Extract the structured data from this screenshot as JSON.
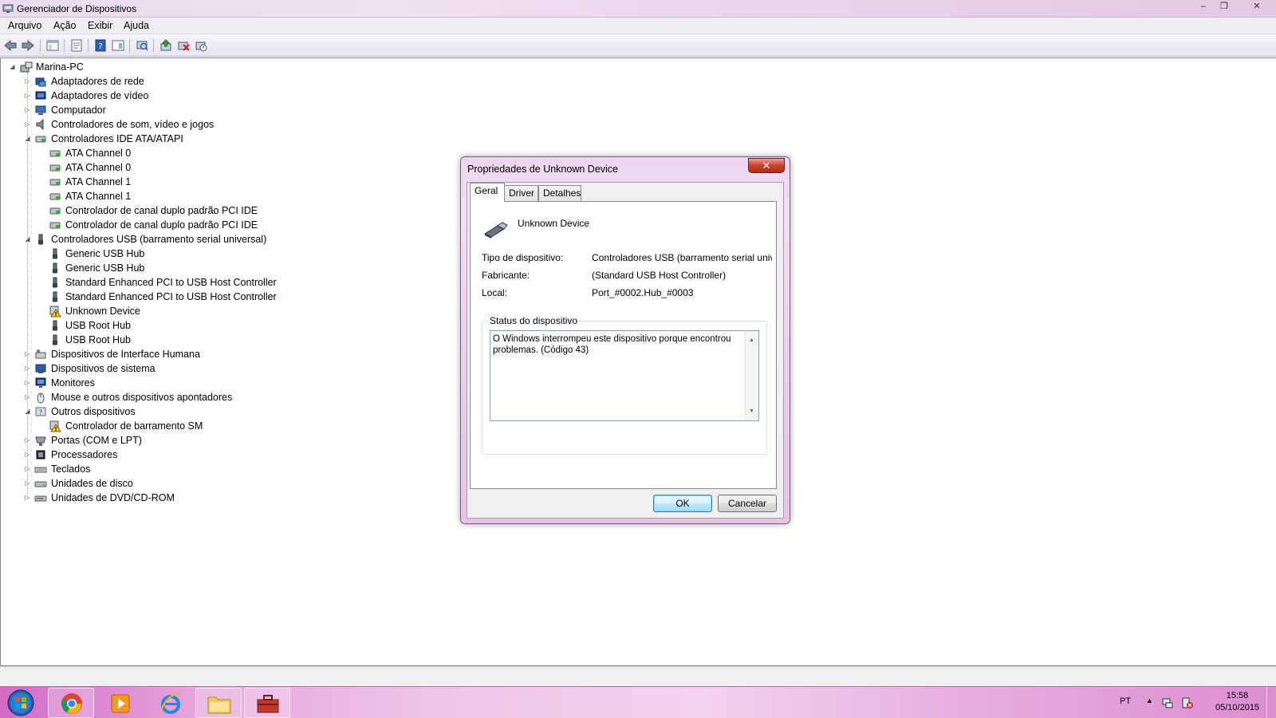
{
  "window": {
    "title": "Gerenciador de Dispositivos",
    "minimize": "‒",
    "maximize": "❐",
    "close": "✕"
  },
  "menu": {
    "items": [
      "Arquivo",
      "Ação",
      "Exibir",
      "Ajuda"
    ]
  },
  "toolbar": {
    "icons": [
      "back-icon",
      "forward-icon",
      "console-tree-icon",
      "properties-icon",
      "help-icon",
      "action-pane-icon",
      "scan-hardware-icon",
      "update-driver-icon",
      "uninstall-icon",
      "disable-icon"
    ]
  },
  "tree": {
    "root": "Marina-PC",
    "nodes": [
      {
        "label": "Adaptadores de rede",
        "icon": "network-adapter-icon",
        "level": 1,
        "expander": "collapsed"
      },
      {
        "label": "Adaptadores de vídeo",
        "icon": "display-adapter-icon",
        "level": 1,
        "expander": "collapsed"
      },
      {
        "label": "Computador",
        "icon": "computer-icon",
        "level": 1,
        "expander": "collapsed"
      },
      {
        "label": "Controladores de som, vídeo e jogos",
        "icon": "speaker-icon",
        "level": 1,
        "expander": "collapsed"
      },
      {
        "label": "Controladores IDE ATA/ATAPI",
        "icon": "ide-controller-icon",
        "level": 1,
        "expander": "expanded"
      },
      {
        "label": "ATA Channel 0",
        "icon": "ide-channel-icon",
        "level": 2
      },
      {
        "label": "ATA Channel 0",
        "icon": "ide-channel-icon",
        "level": 2
      },
      {
        "label": "ATA Channel 1",
        "icon": "ide-channel-icon",
        "level": 2
      },
      {
        "label": "ATA Channel 1",
        "icon": "ide-channel-icon",
        "level": 2
      },
      {
        "label": "Controlador de canal duplo padrão PCI IDE",
        "icon": "ide-channel-icon",
        "level": 2
      },
      {
        "label": "Controlador de canal duplo padrão PCI IDE",
        "icon": "ide-channel-icon",
        "level": 2
      },
      {
        "label": "Controladores USB (barramento serial universal)",
        "icon": "usb-icon",
        "level": 1,
        "expander": "expanded"
      },
      {
        "label": "Generic USB Hub",
        "icon": "usb-plug-icon",
        "level": 2
      },
      {
        "label": "Generic USB Hub",
        "icon": "usb-plug-icon",
        "level": 2
      },
      {
        "label": "Standard Enhanced PCI to USB Host Controller",
        "icon": "usb-plug-icon",
        "level": 2
      },
      {
        "label": "Standard Enhanced PCI to USB Host Controller",
        "icon": "usb-plug-icon",
        "level": 2
      },
      {
        "label": "Unknown Device",
        "icon": "warning-icon",
        "level": 2
      },
      {
        "label": "USB Root Hub",
        "icon": "usb-plug-icon",
        "level": 2
      },
      {
        "label": "USB Root Hub",
        "icon": "usb-plug-icon",
        "level": 2
      },
      {
        "label": "Dispositivos de Interface Humana",
        "icon": "hid-icon",
        "level": 1,
        "expander": "collapsed"
      },
      {
        "label": "Dispositivos de sistema",
        "icon": "system-device-icon",
        "level": 1,
        "expander": "collapsed"
      },
      {
        "label": "Monitores",
        "icon": "monitor-icon",
        "level": 1,
        "expander": "collapsed"
      },
      {
        "label": "Mouse e outros dispositivos apontadores",
        "icon": "mouse-icon",
        "level": 1,
        "expander": "collapsed"
      },
      {
        "label": "Outros dispositivos",
        "icon": "other-devices-icon",
        "level": 1,
        "expander": "expanded"
      },
      {
        "label": "Controlador de barramento SM",
        "icon": "warning-icon",
        "level": 2
      },
      {
        "label": "Portas (COM e LPT)",
        "icon": "port-icon",
        "level": 1,
        "expander": "collapsed"
      },
      {
        "label": "Processadores",
        "icon": "processor-icon",
        "level": 1,
        "expander": "collapsed"
      },
      {
        "label": "Teclados",
        "icon": "keyboard-icon",
        "level": 1,
        "expander": "collapsed"
      },
      {
        "label": "Unidades de disco",
        "icon": "disk-drive-icon",
        "level": 1,
        "expander": "collapsed"
      },
      {
        "label": "Unidades de DVD/CD-ROM",
        "icon": "dvd-drive-icon",
        "level": 1,
        "expander": "collapsed"
      }
    ]
  },
  "dialog": {
    "title": "Propriedades de Unknown Device",
    "close": "✕",
    "tabs": [
      "Geral",
      "Driver",
      "Detalhes"
    ],
    "active_tab": "Geral",
    "device_name": "Unknown Device",
    "props": {
      "type_label": "Tipo de dispositivo:",
      "type_value": "Controladores USB (barramento serial universa",
      "maker_label": "Fabricante:",
      "maker_value": "(Standard USB Host Controller)",
      "location_label": "Local:",
      "location_value": "Port_#0002.Hub_#0003"
    },
    "status_title": "Status do dispositivo",
    "status_text": "O Windows interrompeu este dispositivo porque encontrou problemas. (Código 43)",
    "ok": "OK",
    "cancel": "Cancelar"
  },
  "taskbar": {
    "apps": [
      "chrome-icon",
      "media-player-icon",
      "internet-explorer-icon",
      "file-explorer-icon",
      "device-manager-icon"
    ],
    "lang": "PT",
    "time": "15:58",
    "date": "05/10/2015"
  },
  "colors": {
    "title_tint": "#ead7ea",
    "taskbar_pink": "#e6a4dc",
    "dialog_border": "#7a5e8a",
    "close_red": "#c8432d"
  }
}
